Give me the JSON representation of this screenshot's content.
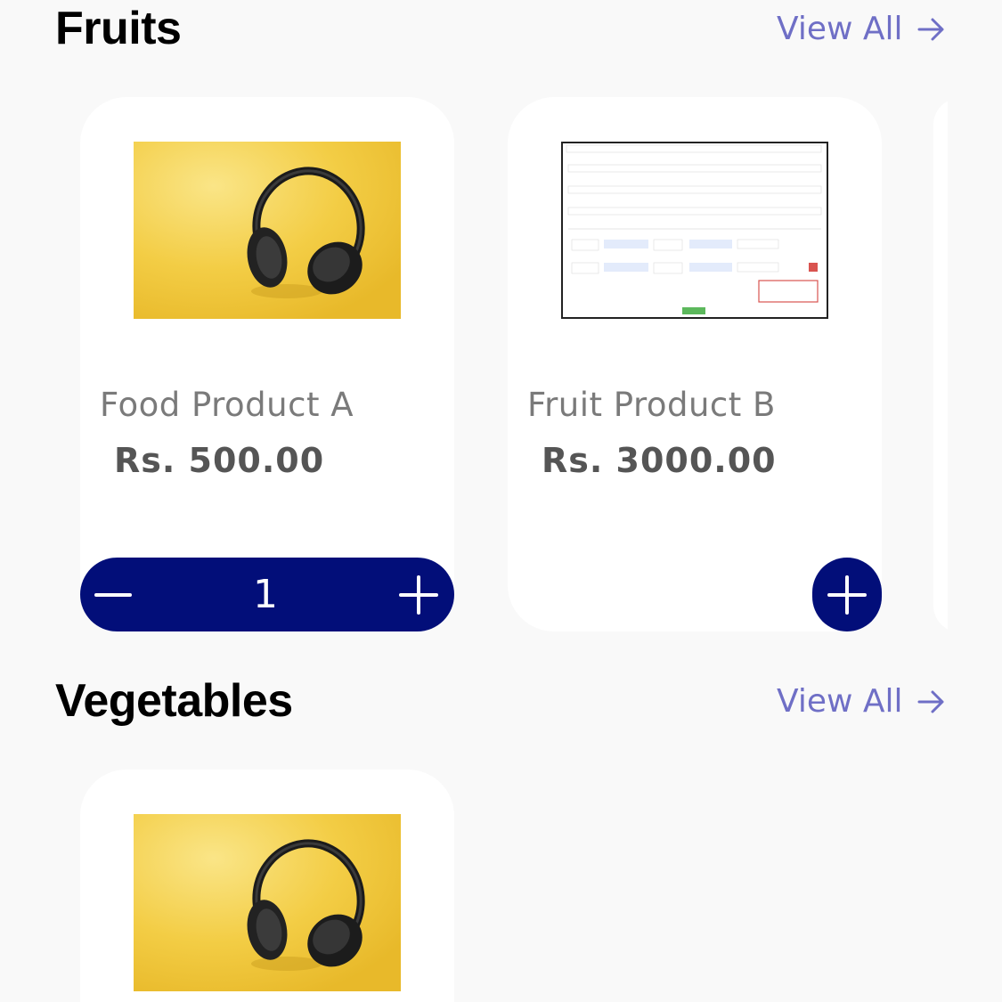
{
  "sections": [
    {
      "title": "Fruits",
      "view_all_label": "View All",
      "products": [
        {
          "name": "Food Product A",
          "price": "Rs. 500.00",
          "image": "headphones-on-yellow",
          "quantity": "1",
          "in_cart": true
        },
        {
          "name": "Fruit Product B",
          "price": "Rs. 3000.00",
          "image": "form-screenshot",
          "in_cart": false
        }
      ]
    },
    {
      "title": "Vegetables",
      "view_all_label": "View All",
      "products": [
        {
          "image": "headphones-on-yellow"
        }
      ]
    }
  ],
  "colors": {
    "background": "#f9f9f9",
    "card": "#ffffff",
    "accent": "#020e79",
    "link": "#6f6fc6",
    "product_name": "#7a7a7a",
    "price": "#555555"
  },
  "icons": {
    "arrow": "arrow-right-icon",
    "minus": "minus-icon",
    "plus": "plus-icon"
  }
}
